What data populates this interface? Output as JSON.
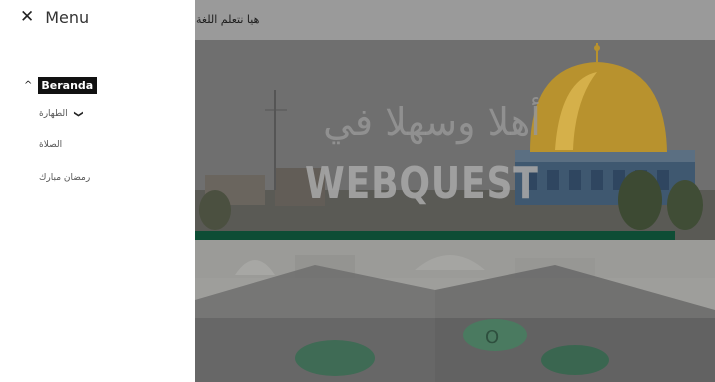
{
  "header": {
    "title": "هيا نتعلم اللغة"
  },
  "hero": {
    "arabic_text": "أهلا وسهلا في",
    "logo_text": "WEBQUEST"
  },
  "sidebar": {
    "close_label": "✕",
    "menu_label": "Menu",
    "main_item": {
      "label": "Beranda",
      "expanded": true
    },
    "sub_items": [
      {
        "label": "الطهارة",
        "has_children": true
      },
      {
        "label": "الصلاة",
        "has_children": false
      },
      {
        "label": "رمضان مبارك",
        "has_children": false
      }
    ]
  },
  "colors": {
    "overlay": "#8b8b8b",
    "accent_bar": "#0e4d35",
    "active_item_bg": "#111111"
  },
  "icons": {
    "close": "close-icon",
    "expand": "chevron-up-icon",
    "submenu": "chevron-down-icon"
  }
}
